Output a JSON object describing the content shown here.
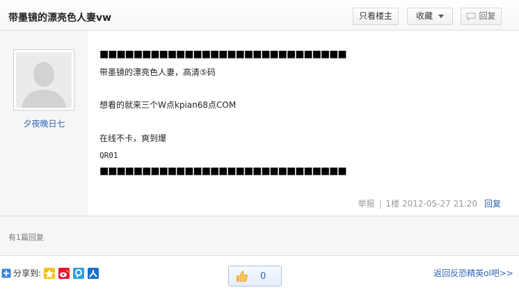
{
  "thread": {
    "title": "带墨镜的漂亮色人妻vw",
    "only_author_label": "只看楼主",
    "favorite_label": "收藏",
    "reply_label": "回复"
  },
  "post": {
    "author": "夕夜晚日七",
    "lines": [
      "■■■■■■■■■■■■■■■■■■■■■■■■■■■■■",
      "带墨镜的漂亮色人妻，高清⑤码",
      "想看的就来三个W点kpian68点COM",
      "在线不卡，爽到爆",
      "QR01",
      "■■■■■■■■■■■■■■■■■■■■■■■■■■■■■"
    ],
    "report_label": "举报",
    "separator": "|",
    "floor": "1楼",
    "timestamp": "2012-05-27 21:20",
    "reply_label": "回复"
  },
  "replies": {
    "count_text": "有1篇回复"
  },
  "footer": {
    "share_label": "分享到:",
    "share_icons": [
      "qzone-icon",
      "weibo-icon",
      "pengyou-icon",
      "renren-icon"
    ],
    "like_count": "0",
    "back_link": "返回反恐精英ol吧>>"
  },
  "colors": {
    "link": "#2d64b3",
    "panel": "#f6f6f6",
    "border": "#dcdcdc"
  }
}
